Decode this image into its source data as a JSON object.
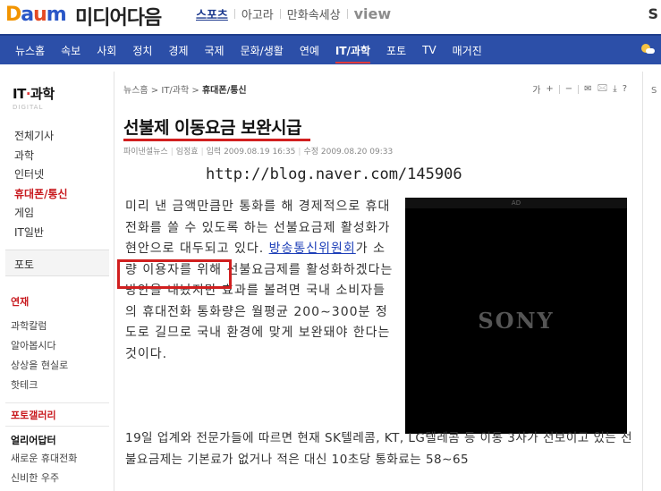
{
  "brand": {
    "logo_d": "D",
    "logo_a": "a",
    "logo_u": "u",
    "logo_m": "m",
    "title": "미디어다음"
  },
  "top_links": [
    "스포츠",
    "아고라",
    "만화속세상",
    "view"
  ],
  "corner_letter": "S",
  "nav": {
    "items": [
      "뉴스홈",
      "속보",
      "사회",
      "정치",
      "경제",
      "국제",
      "문화/생활",
      "연예",
      "IT/과학",
      "포토",
      "TV",
      "매거진"
    ],
    "active_index": 8
  },
  "sidebar": {
    "heading_left": "IT",
    "heading_dot": "·",
    "heading_right": "과학",
    "heading_sub": "DIGITAL",
    "items": [
      "전체기사",
      "과학",
      "인터넷",
      "휴대폰/통신",
      "게임",
      "IT일반"
    ],
    "active_item": "휴대폰/통신",
    "photo": "포토",
    "section1": "연재",
    "section1_items": [
      "과학칼럼",
      "알아봅시다",
      "상상을 현실로",
      "핫테크"
    ],
    "section2": "포토갤러리",
    "section3": "얼리어답터",
    "section3_items": [
      "새로운 휴대전화",
      "신비한 우주"
    ]
  },
  "breadcrumb": {
    "home": "뉴스홈",
    "cat": "IT/과학",
    "current": "휴대폰/통신",
    "sep": ">"
  },
  "tools": [
    "가",
    "+",
    "−",
    "✉",
    "🖂",
    "⤓",
    "?"
  ],
  "article": {
    "headline": "선불제 이동요금 보완시급",
    "source": "파이낸셜뉴스",
    "reporter": "임정효",
    "input_label": "입력",
    "input_time": "2009.08.19 16:35",
    "edit_label": "수정",
    "edit_time": "2009.08.20 09:33",
    "watermark": "http://blog.naver.com/145906",
    "para1_a": "미리 낸 금액만큼만 통화를 해 경제적으로 휴대전화를 쓸 수 있도록 하는 선불요금제 활성화가 현안으로 대두되고 있다. ",
    "para1_link": "방송통신위원회",
    "para1_b": "가 소량 이용자를 위해 선불요금제를 활성화하겠다는 방안을 내놨지만 효과를 볼려면 국내 소비자들의 휴대전화 통화량은 월평균 200∼300분 정도로 길므로 국내 환경에 맞게 보완돼야 한다는 것이다.",
    "para2": "19일 업계와 전문가들에 따르면 현재 SK텔레콤, KT, LG텔레콤 등 이통 3사가 선보이고 있는 선불요금제는 기본료가 없거나 적은 대신 10초당 통화료는 58∼65"
  },
  "ad": {
    "label": "AD",
    "brand": "SONY"
  },
  "right_strip_letter": "S",
  "colors": {
    "nav_bg": "#2c4fa8",
    "accent_red": "#d11f1f",
    "link_blue": "#1d3fb8"
  }
}
